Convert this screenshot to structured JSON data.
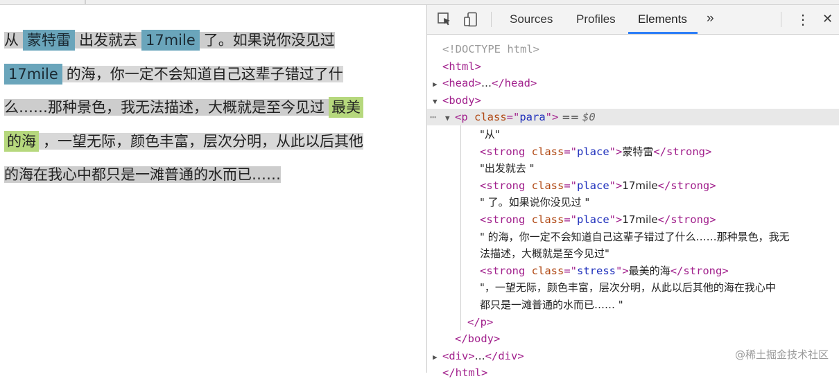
{
  "page": {
    "lines": [
      [
        {
          "t": "text",
          "v": "从"
        },
        {
          "t": "place",
          "v": "蒙特雷"
        },
        {
          "t": "text",
          "v": "出发就去"
        },
        {
          "t": "place",
          "v": "17mile"
        },
        {
          "t": "text",
          "v": "了。如果说你没见过"
        }
      ],
      [
        {
          "t": "place",
          "v": "17mile"
        },
        {
          "t": "text",
          "v": "的海，你一定不会知道自己这辈子错过了什"
        }
      ],
      [
        {
          "t": "text",
          "v": "么……那种景色，我无法描述，大概就是至今见过"
        },
        {
          "t": "stress",
          "v": "最美"
        }
      ],
      [
        {
          "t": "stress",
          "v": "的海"
        },
        {
          "t": "text",
          "v": "，一望无际，颜色丰富，层次分明，从此以后其他"
        }
      ],
      [
        {
          "t": "text",
          "v": "的海在我心中都只是一滩普通的水而已……"
        }
      ]
    ]
  },
  "devtools": {
    "tabs": [
      "Sources",
      "Profiles",
      "Elements"
    ],
    "active_tab": "Elements",
    "more": "»",
    "menu": "⋮",
    "close": "✕",
    "dom": [
      {
        "indent": 0,
        "tri": "",
        "parts": [
          [
            "doctype",
            "<!DOCTYPE html>"
          ]
        ]
      },
      {
        "indent": 0,
        "tri": "",
        "parts": [
          [
            "tag",
            "<html>"
          ]
        ]
      },
      {
        "indent": 0,
        "tri": "▶",
        "parts": [
          [
            "tag",
            "<head>"
          ],
          [
            "txt",
            "…"
          ],
          [
            "tag",
            "</head>"
          ]
        ]
      },
      {
        "indent": 0,
        "tri": "▼",
        "parts": [
          [
            "tag",
            "<body>"
          ]
        ]
      },
      {
        "indent": 1,
        "tri": "▼",
        "selected": true,
        "parts": [
          [
            "tag",
            "<p "
          ],
          [
            "attr",
            "class"
          ],
          [
            "tag",
            "=\""
          ],
          [
            "val",
            "para"
          ],
          [
            "tag",
            "\">"
          ],
          [
            "txt",
            " == "
          ],
          [
            "dollar",
            "$0"
          ]
        ]
      },
      {
        "indent": 3,
        "tri": "",
        "parts": [
          [
            "txt",
            "\"从\""
          ]
        ]
      },
      {
        "indent": 3,
        "tri": "",
        "parts": [
          [
            "tag",
            "<strong "
          ],
          [
            "attr",
            "class"
          ],
          [
            "tag",
            "=\""
          ],
          [
            "val",
            "place"
          ],
          [
            "tag",
            "\">"
          ],
          [
            "txt",
            "蒙特雷"
          ],
          [
            "tag",
            "</strong>"
          ]
        ]
      },
      {
        "indent": 3,
        "tri": "",
        "parts": [
          [
            "txt",
            "\"出发就去 \""
          ]
        ]
      },
      {
        "indent": 3,
        "tri": "",
        "parts": [
          [
            "tag",
            "<strong "
          ],
          [
            "attr",
            "class"
          ],
          [
            "tag",
            "=\""
          ],
          [
            "val",
            "place"
          ],
          [
            "tag",
            "\">"
          ],
          [
            "txt",
            "17mile"
          ],
          [
            "tag",
            "</strong>"
          ]
        ]
      },
      {
        "indent": 3,
        "tri": "",
        "parts": [
          [
            "txt",
            "\" 了。如果说你没见过 \""
          ]
        ]
      },
      {
        "indent": 3,
        "tri": "",
        "parts": [
          [
            "tag",
            "<strong "
          ],
          [
            "attr",
            "class"
          ],
          [
            "tag",
            "=\""
          ],
          [
            "val",
            "place"
          ],
          [
            "tag",
            "\">"
          ],
          [
            "txt",
            "17mile"
          ],
          [
            "tag",
            "</strong>"
          ]
        ]
      },
      {
        "indent": 3,
        "tri": "",
        "parts": [
          [
            "txt",
            "\" 的海，你一定不会知道自己这辈子错过了什么……那种景色，我无"
          ]
        ]
      },
      {
        "indent": 3,
        "tri": "",
        "parts": [
          [
            "txt",
            "法描述，大概就是至今见过\""
          ]
        ]
      },
      {
        "indent": 3,
        "tri": "",
        "parts": [
          [
            "tag",
            "<strong "
          ],
          [
            "attr",
            "class"
          ],
          [
            "tag",
            "=\""
          ],
          [
            "val",
            "stress"
          ],
          [
            "tag",
            "\">"
          ],
          [
            "txt",
            "最美的海"
          ],
          [
            "tag",
            "</strong>"
          ]
        ]
      },
      {
        "indent": 3,
        "tri": "",
        "parts": [
          [
            "txt",
            "\"，一望无际，颜色丰富，层次分明，从此以后其他的海在我心中"
          ]
        ]
      },
      {
        "indent": 3,
        "tri": "",
        "parts": [
          [
            "txt",
            "都只是一滩普通的水而已…… \""
          ]
        ]
      },
      {
        "indent": 2,
        "tri": "",
        "parts": [
          [
            "tag",
            "</p>"
          ]
        ]
      },
      {
        "indent": 1,
        "tri": "",
        "parts": [
          [
            "tag",
            "</body>"
          ]
        ]
      },
      {
        "indent": 0,
        "tri": "▶",
        "parts": [
          [
            "tag",
            "<div>"
          ],
          [
            "txt",
            "…"
          ],
          [
            "tag",
            "</div>"
          ]
        ]
      },
      {
        "indent": 0,
        "tri": "",
        "parts": [
          [
            "tag",
            "</html>"
          ]
        ]
      }
    ]
  },
  "watermark": "@稀土掘金技术社区",
  "colors": {
    "place_bg": "#6aa5bb",
    "stress_bg": "#b6d87d",
    "para_bg": "#cdcdcd",
    "tab_underline": "#2d7ef7"
  }
}
